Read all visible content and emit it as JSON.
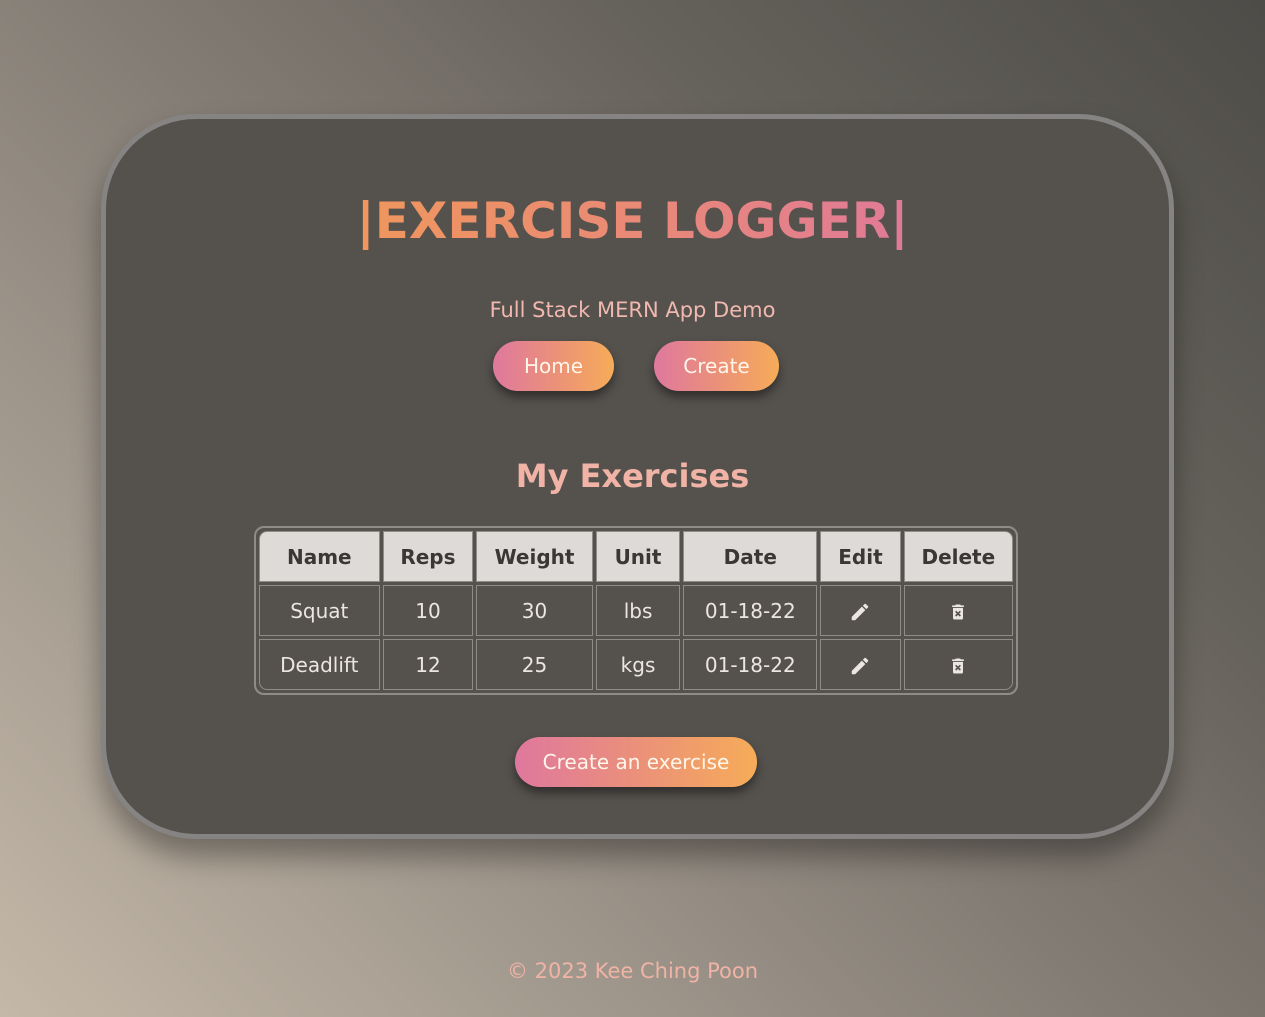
{
  "header": {
    "title": "|EXERCISE LOGGER|",
    "subtitle": "Full Stack MERN App Demo"
  },
  "nav": {
    "home_label": "Home",
    "create_label": "Create"
  },
  "main": {
    "section_title": "My Exercises",
    "table": {
      "columns": [
        "Name",
        "Reps",
        "Weight",
        "Unit",
        "Date",
        "Edit",
        "Delete"
      ],
      "rows": [
        {
          "name": "Squat",
          "reps": "10",
          "weight": "30",
          "unit": "lbs",
          "date": "01-18-22",
          "edit_icon": "pencil-icon",
          "delete_icon": "trash-icon"
        },
        {
          "name": "Deadlift",
          "reps": "12",
          "weight": "25",
          "unit": "kgs",
          "date": "01-18-22",
          "edit_icon": "pencil-icon",
          "delete_icon": "trash-icon"
        }
      ]
    },
    "create_exercise_label": "Create an exercise"
  },
  "footer": {
    "copyright": "© 2023 Kee Ching Poon"
  },
  "colors": {
    "card_background": "#55524e",
    "card_border": "#858483",
    "accent_gradient_start": "#df789e",
    "accent_gradient_end": "#f6ac58",
    "title_text": "#ec8a70",
    "subtitle_text": "#f0b8ae",
    "table_header_background": "#dedad8"
  }
}
